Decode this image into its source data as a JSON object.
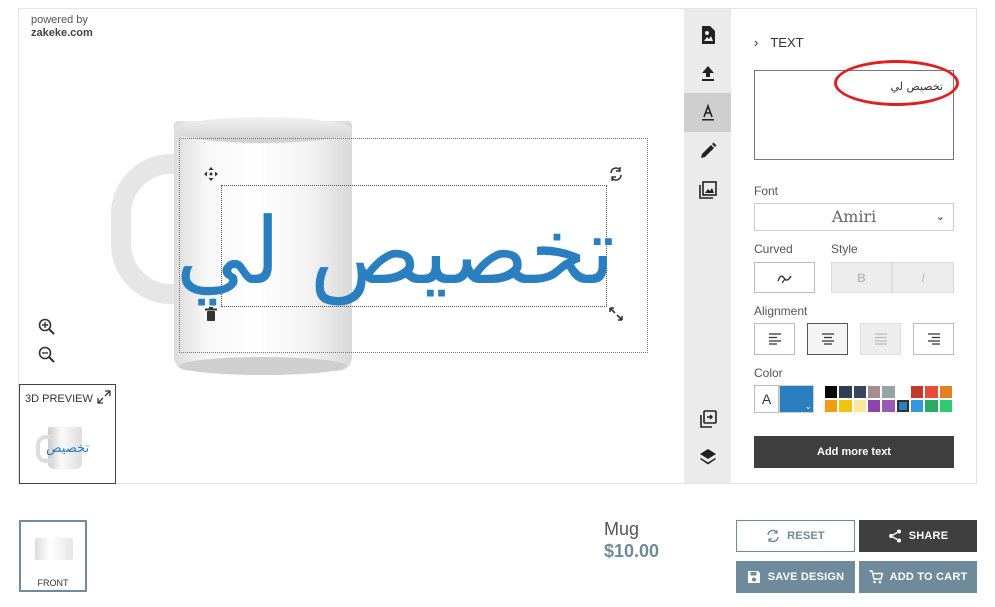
{
  "branding": {
    "powered_by": "powered by",
    "site": "zakeke.com"
  },
  "canvas": {
    "design_text": "تخصيص لي",
    "preview_label": "3D PREVIEW",
    "mini_text": "تخصيص"
  },
  "toolbar": {
    "tools": [
      {
        "icon": "template-icon"
      },
      {
        "icon": "upload-icon"
      },
      {
        "icon": "text-tool-icon",
        "active": true
      },
      {
        "icon": "draw-icon"
      },
      {
        "icon": "image-gallery-icon"
      }
    ],
    "bottom_tools": [
      {
        "icon": "copy-to-sides-icon"
      },
      {
        "icon": "layers-icon"
      }
    ]
  },
  "panel": {
    "section_title": "TEXT",
    "text_value": "تخصيص لي",
    "font_label": "Font",
    "font_value": "Amiri",
    "curved_label": "Curved",
    "style_label": "Style",
    "bold_label": "B",
    "italic_label": "I",
    "alignment_label": "Alignment",
    "color_label": "Color",
    "color_letter": "A",
    "selected_color": "#2b7fc1",
    "palette": [
      "#000000",
      "#2c3e50",
      "#34495e",
      "#a58d8d",
      "#95a5a6",
      "#ffffff",
      "#c0392b",
      "#e74c3c",
      "#e67e22",
      "#f39c12",
      "#f1c40f",
      "#f9e79f",
      "#8e44ad",
      "#9b59b6",
      "#2b7fc1",
      "#3498db",
      "#27ae60",
      "#2ecc71"
    ],
    "selected_palette_index": 14,
    "add_text_label": "Add more text"
  },
  "footer": {
    "side_label": "FRONT",
    "product_name": "Mug",
    "product_price": "$10.00",
    "reset_label": "RESET",
    "share_label": "SHARE",
    "save_label": "SAVE DESIGN",
    "cart_label": "ADD TO CART"
  }
}
